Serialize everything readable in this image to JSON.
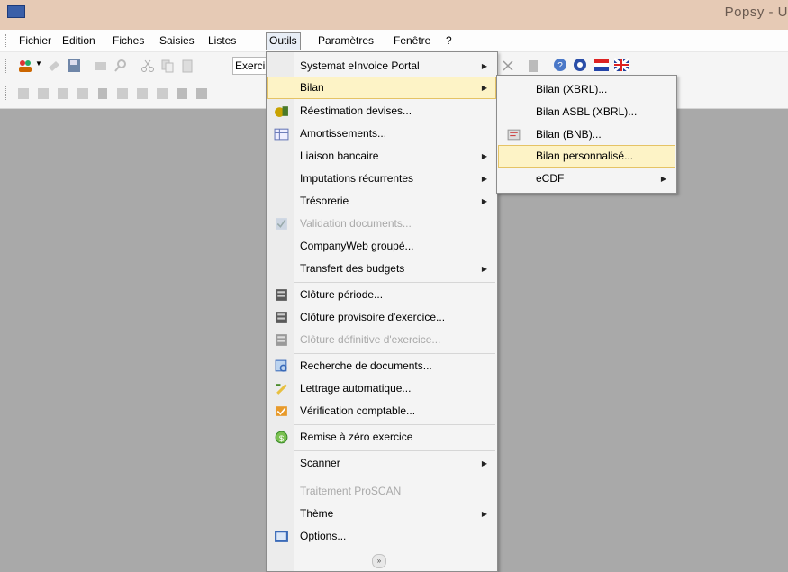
{
  "window": {
    "title": "Popsy - U"
  },
  "menubar": [
    {
      "label": "Fichier",
      "active": false
    },
    {
      "label": "Edition",
      "active": false
    },
    {
      "label": "Fiches",
      "active": false
    },
    {
      "label": "Saisies",
      "active": false
    },
    {
      "label": "Listes",
      "active": false
    },
    {
      "label": "Outils",
      "active": true
    },
    {
      "label": "Paramètres",
      "active": false
    },
    {
      "label": "Fenêtre",
      "active": false
    },
    {
      "label": "?",
      "active": false
    }
  ],
  "toolbar": {
    "exercice_label": "Exerci"
  },
  "outils_menu": {
    "items": [
      {
        "label": "Systemat eInvoice Portal",
        "submenu": true,
        "enabled": true,
        "icon": "none"
      },
      {
        "label": "Bilan",
        "submenu": true,
        "enabled": true,
        "highlighted": true,
        "icon": "none"
      },
      {
        "label": "Réestimation devises...",
        "submenu": false,
        "enabled": true,
        "icon": "currency-icon"
      },
      {
        "label": "Amortissements...",
        "submenu": false,
        "enabled": true,
        "icon": "table-icon"
      },
      {
        "label": "Liaison bancaire",
        "submenu": true,
        "enabled": true,
        "icon": "none"
      },
      {
        "label": "Imputations récurrentes",
        "submenu": true,
        "enabled": true,
        "icon": "none"
      },
      {
        "label": "Trésorerie",
        "submenu": true,
        "enabled": true,
        "icon": "none"
      },
      {
        "label": "Validation documents...",
        "submenu": false,
        "enabled": false,
        "icon": "validate-icon"
      },
      {
        "label": "CompanyWeb groupé...",
        "submenu": false,
        "enabled": true,
        "icon": "none"
      },
      {
        "label": "Transfert des budgets",
        "submenu": true,
        "enabled": true,
        "icon": "none"
      },
      {
        "label": "Clôture période...",
        "submenu": false,
        "enabled": true,
        "icon": "close-period-icon"
      },
      {
        "label": "Clôture provisoire d'exercice...",
        "submenu": false,
        "enabled": true,
        "icon": "provisional-close-icon"
      },
      {
        "label": "Clôture définitive d'exercice...",
        "submenu": false,
        "enabled": false,
        "icon": "final-close-icon"
      },
      {
        "label": "Recherche de documents...",
        "submenu": false,
        "enabled": true,
        "icon": "document-search-icon"
      },
      {
        "label": "Lettrage automatique...",
        "submenu": false,
        "enabled": true,
        "icon": "auto-lettering-icon"
      },
      {
        "label": "Vérification comptable...",
        "submenu": false,
        "enabled": true,
        "icon": "accounting-check-icon"
      },
      {
        "label": "Remise à zéro exercice",
        "submenu": false,
        "enabled": true,
        "icon": "reset-icon"
      },
      {
        "label": "Scanner",
        "submenu": true,
        "enabled": true,
        "icon": "none"
      },
      {
        "label": "Traitement ProSCAN",
        "submenu": false,
        "enabled": false,
        "icon": "none"
      },
      {
        "label": "Thème",
        "submenu": true,
        "enabled": true,
        "icon": "none"
      },
      {
        "label": "Options...",
        "submenu": false,
        "enabled": true,
        "icon": "options-icon"
      }
    ]
  },
  "bilan_menu": {
    "items": [
      {
        "label": "Bilan (XBRL)...",
        "submenu": false,
        "icon": "none"
      },
      {
        "label": "Bilan ASBL (XBRL)...",
        "submenu": false,
        "icon": "none"
      },
      {
        "label": "Bilan (BNB)...",
        "submenu": false,
        "icon": "bnb-icon"
      },
      {
        "label": "Bilan personnalisé...",
        "submenu": false,
        "highlighted": true,
        "icon": "none"
      },
      {
        "label": "eCDF",
        "submenu": true,
        "icon": "none"
      }
    ]
  },
  "colors": {
    "highlight": "#fdf3c6",
    "titlebar": "#e6cab5",
    "workarea": "#a9a9a9"
  }
}
